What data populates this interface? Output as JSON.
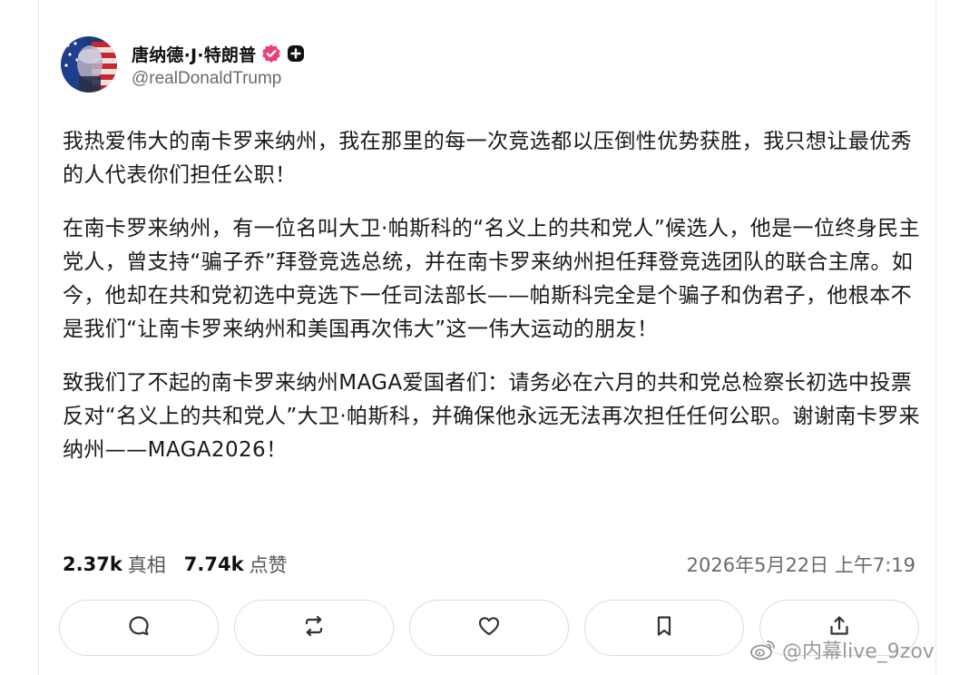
{
  "author": {
    "display_name": "唐纳德·J·特朗普",
    "handle": "@realDonaldTrump",
    "avatar_icon": "avatar-flag-portrait",
    "verified_icon": "verified-badge-icon",
    "verified_color": "#e8407a",
    "plus_icon": "plus-badge-icon"
  },
  "post": {
    "paragraphs": [
      "我热爱伟大的南卡罗来纳州，我在那里的每一次竞选都以压倒性优势获胜，我只想让最优秀的人代表你们担任公职！",
      "在南卡罗来纳州，有一位名叫大卫·帕斯科的“名义上的共和党人”候选人，他是一位终身民主党人，曾支持“骗子乔”拜登竞选总统，并在南卡罗来纳州担任拜登竞选团队的联合主席。如今，他却在共和党初选中竞选下一任司法部长——帕斯科完全是个骗子和伪君子，他根本不是我们“让南卡罗来纳州和美国再次伟大”这一伟大运动的朋友！",
      "致我们了不起的南卡罗来纳州MAGA爱国者们：请务必在六月的共和党总检察长初选中投票反对“名义上的共和党人”大卫·帕斯科，并确保他永远无法再次担任任何公职。谢谢南卡罗来纳州——MAGA2026！"
    ]
  },
  "stats": {
    "truths_count": "2.37k",
    "truths_label": "真相",
    "likes_count": "7.74k",
    "likes_label": "点赞",
    "timestamp": "2026年5月22日 上午7:19"
  },
  "actions": [
    {
      "icon": "reply-icon"
    },
    {
      "icon": "retruth-icon"
    },
    {
      "icon": "like-icon"
    },
    {
      "icon": "bookmark-icon"
    },
    {
      "icon": "share-icon"
    }
  ],
  "watermark": {
    "text": "@内幕live_9zov",
    "icon": "weibo-logo-icon"
  }
}
